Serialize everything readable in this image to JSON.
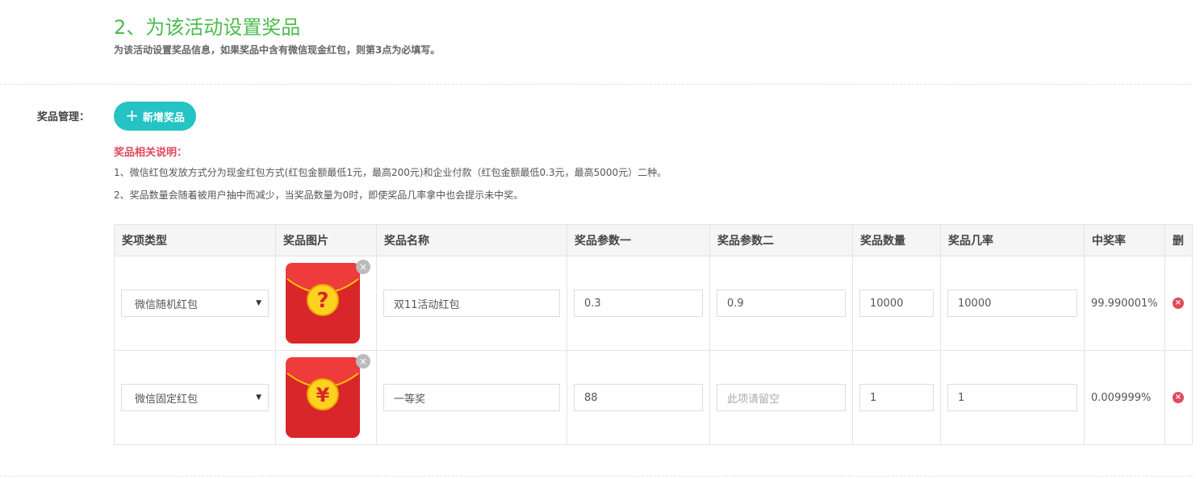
{
  "section": {
    "title": "2、为该活动设置奖品",
    "description": "为该活动设置奖品信息，如果奖品中含有微信现金红包，则第3点为必填写。"
  },
  "prize_management": {
    "label": "奖品管理：",
    "add_button_label": "新增奖品",
    "add_button_icon": "plus-icon"
  },
  "notes": {
    "title": "奖品相关说明：",
    "lines": [
      "1、微信红包发放方式分为现金红包方式(红包金额最低1元，最高200元)和企业付款（红包金额最低0.3元，最高5000元）二种。",
      "2、奖品数量会随着被用户抽中而减少，当奖品数量为0时，即使奖品几率拿中也会提示未中奖。"
    ]
  },
  "table": {
    "headers": [
      "奖项类型",
      "奖品图片",
      "奖品名称",
      "奖品参数一",
      "奖品参数二",
      "奖品数量",
      "奖品几率",
      "中奖率",
      "删"
    ],
    "rows": [
      {
        "type": "微信随机红包",
        "image_icon": "red-envelope-question-icon",
        "image_symbol": "?",
        "name": "双11活动红包",
        "param1": "0.3",
        "param2": "0.9",
        "param2_placeholder": "",
        "quantity": "10000",
        "probability": "10000",
        "win_rate": "99.990001%"
      },
      {
        "type": "微信固定红包",
        "image_icon": "red-envelope-yuan-icon",
        "image_symbol": "¥",
        "name": "一等奖",
        "param1": "88",
        "param2": "",
        "param2_placeholder": "此项请留空",
        "quantity": "1",
        "probability": "1",
        "win_rate": "0.009999%"
      }
    ]
  },
  "colors": {
    "title_green": "#4cbb4c",
    "button_teal": "#25c3c3",
    "notes_red": "#e0495a",
    "envelope_red": "#d9262a",
    "coin_yellow": "#ffd21f"
  }
}
